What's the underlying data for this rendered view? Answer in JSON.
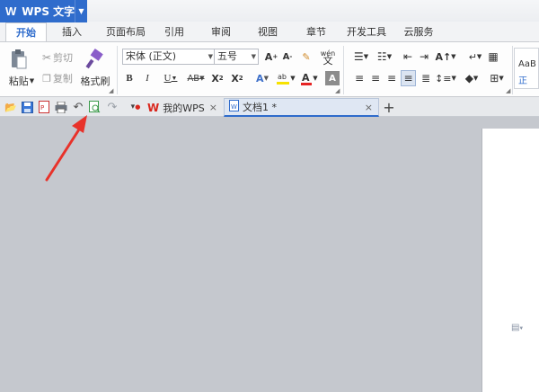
{
  "app": {
    "title": "WPS 文字",
    "logo": "W"
  },
  "tabs": [
    {
      "label": "开始",
      "active": true
    },
    {
      "label": "插入"
    },
    {
      "label": "页面布局"
    },
    {
      "label": "引用"
    },
    {
      "label": "审阅"
    },
    {
      "label": "视图"
    },
    {
      "label": "章节"
    },
    {
      "label": "开发工具"
    },
    {
      "label": "云服务"
    }
  ],
  "ribbon": {
    "paste": "粘贴",
    "cut": "剪切",
    "copy": "复制",
    "format_painter": "格式刷",
    "font_name": "宋体 (正文)",
    "font_size": "五号",
    "style_preview": "AaB",
    "style_preview_sub": "正"
  },
  "quick_access": {
    "doc_tabs": [
      {
        "label": "我的WPS"
      },
      {
        "label": "文档1 *",
        "active": true
      }
    ],
    "add_tab": "+"
  },
  "colors": {
    "accent": "#2f6ccc",
    "wps_red": "#d9261c",
    "arrow_red": "#e8322a",
    "workspace": "#c5c8ce"
  }
}
